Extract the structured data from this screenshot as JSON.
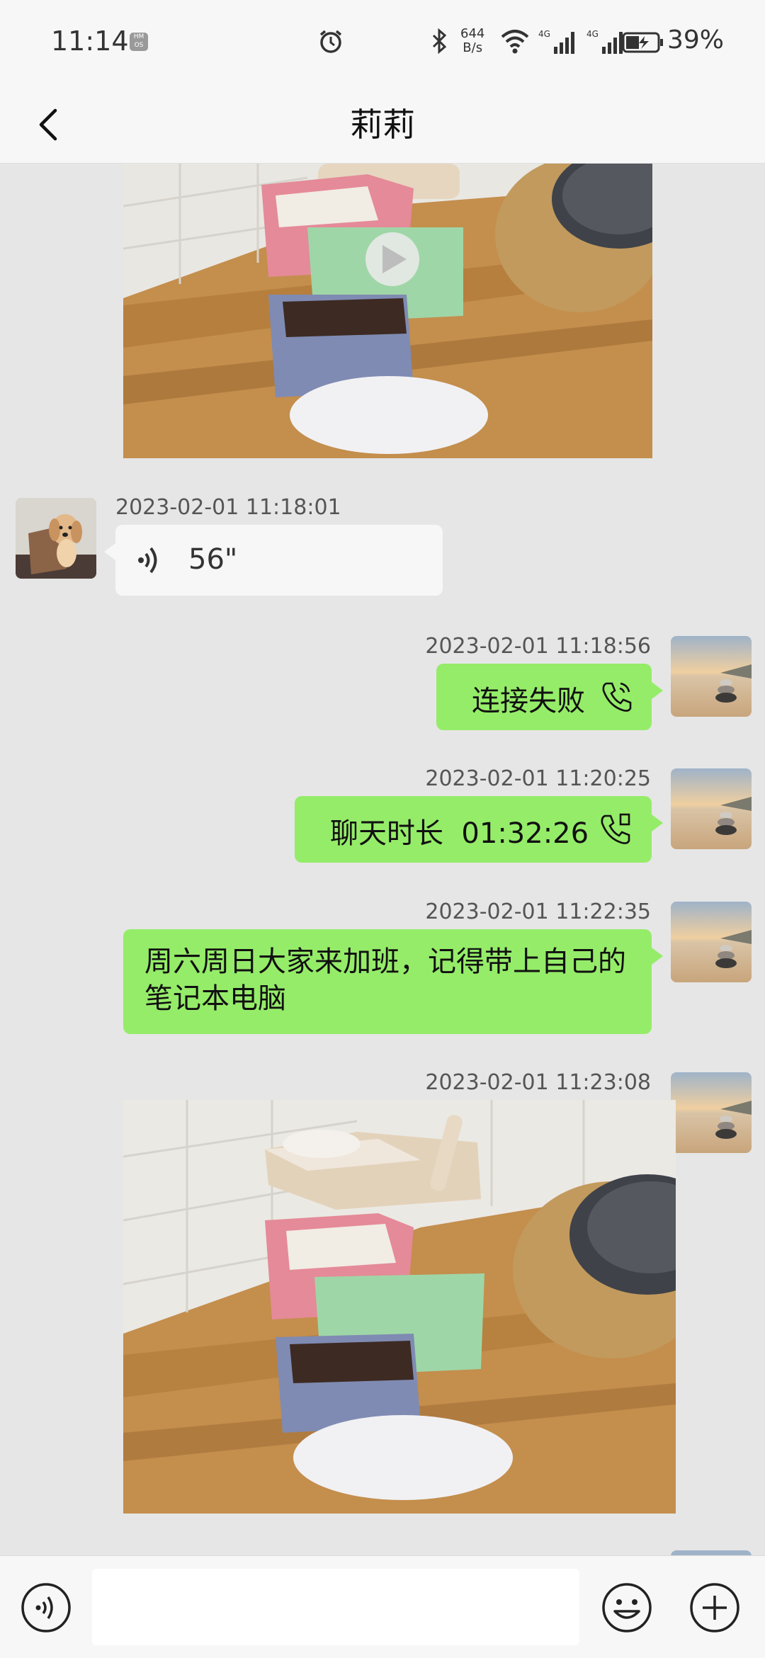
{
  "status_bar": {
    "time": "11:14",
    "hmos_badge": "HM OS",
    "net_speed_value": "644",
    "net_speed_unit": "B/s",
    "sim1_label": "4G",
    "sim2_label": "4G",
    "battery": "39%"
  },
  "header": {
    "title": "莉莉"
  },
  "messages": [
    {
      "type": "video",
      "side": "right"
    },
    {
      "type": "voice",
      "side": "left",
      "timestamp": "2023-02-01 11:18:01",
      "duration": "56\""
    },
    {
      "type": "call",
      "side": "right",
      "timestamp": "2023-02-01 11:18:56",
      "text": "连接失败",
      "icon": "phone-icon"
    },
    {
      "type": "call",
      "side": "right",
      "timestamp": "2023-02-01 11:20:25",
      "text": "聊天时长  01:32:26",
      "icon": "phone-end-icon"
    },
    {
      "type": "text",
      "side": "right",
      "timestamp": "2023-02-01 11:22:35",
      "text": "周六周日大家来加班，记得带上自己的笔记本电脑"
    },
    {
      "type": "image",
      "side": "right",
      "timestamp": "2023-02-01 11:23:08"
    }
  ],
  "input": {
    "placeholder": ""
  },
  "colors": {
    "chat_background": "#e6e6e6",
    "my_bubble": "#95ec69",
    "other_bubble": "#f7f7f7",
    "bar_background": "#f7f7f7"
  }
}
